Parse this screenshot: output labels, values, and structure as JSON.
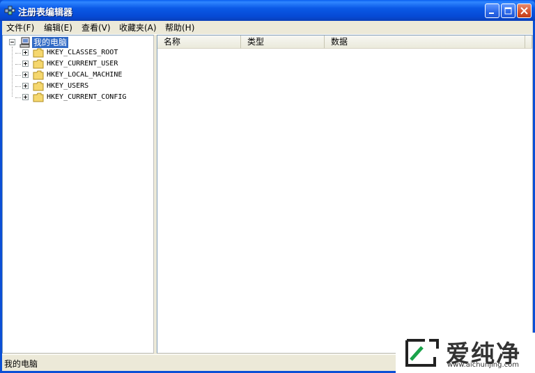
{
  "window": {
    "title": "注册表编辑器",
    "title_icon": "registry-editor-icon",
    "controls": [
      "minimize-icon",
      "maximize-icon",
      "close-icon"
    ]
  },
  "menubar": {
    "items": [
      {
        "label": "文件(F)"
      },
      {
        "label": "编辑(E)"
      },
      {
        "label": "查看(V)"
      },
      {
        "label": "收藏夹(A)"
      },
      {
        "label": "帮助(H)"
      }
    ]
  },
  "tree": {
    "root": {
      "label": "我的电脑",
      "icon": "computer-icon",
      "expanded": true,
      "selected": true
    },
    "children": [
      {
        "label": "HKEY_CLASSES_ROOT",
        "icon": "folder-icon"
      },
      {
        "label": "HKEY_CURRENT_USER",
        "icon": "folder-icon"
      },
      {
        "label": "HKEY_LOCAL_MACHINE",
        "icon": "folder-icon"
      },
      {
        "label": "HKEY_USERS",
        "icon": "folder-icon"
      },
      {
        "label": "HKEY_CURRENT_CONFIG",
        "icon": "folder-icon"
      }
    ]
  },
  "list": {
    "columns": [
      "名称",
      "类型",
      "数据"
    ],
    "rows": []
  },
  "status": {
    "text": "我的电脑"
  },
  "watermark": {
    "brand": "爱纯净",
    "url": "www.aichunjing.com",
    "logo": "aichunjing-logo-icon"
  },
  "colors": {
    "title_bar": "#0a59e6",
    "selection": "#316ac5",
    "chrome": "#ece9d8"
  }
}
